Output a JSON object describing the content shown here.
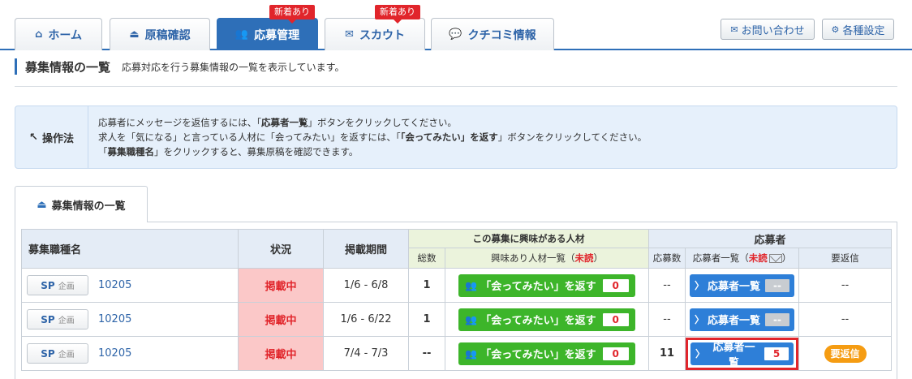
{
  "nav": {
    "tabs": [
      {
        "label": "ホーム",
        "icon": "home-icon",
        "glyph": "⌂",
        "active": false,
        "badge": ""
      },
      {
        "label": "原稿確認",
        "icon": "document-icon",
        "glyph": "⏏",
        "active": false,
        "badge": ""
      },
      {
        "label": "応募管理",
        "icon": "users-icon",
        "glyph": "👥",
        "active": true,
        "badge": "新着あり"
      },
      {
        "label": "スカウト",
        "icon": "mail-icon",
        "glyph": "✉",
        "active": false,
        "badge": "新着あり"
      },
      {
        "label": "クチコミ情報",
        "icon": "chat-icon",
        "glyph": "💬",
        "active": false,
        "badge": ""
      }
    ],
    "contact_label": "お問い合わせ",
    "contact_glyph": "✉",
    "settings_label": "各種設定",
    "settings_glyph": "⚙"
  },
  "header": {
    "title": "募集情報の一覧",
    "description": "応募対応を行う募集情報の一覧を表示しています。"
  },
  "howto": {
    "label": "操作法",
    "glyph": "↖",
    "line1_pre": "応募者にメッセージを返信するには、「",
    "line1_bold": "応募者一覧",
    "line1_post": "」ボタンをクリックしてください。",
    "line2_pre": "求人を「気になる」と言っている人材に「会ってみたい」を返すには、「",
    "line2_bold": "「会ってみたい」を返す",
    "line2_post": "」ボタンをクリックしてください。",
    "line3_pre": "「",
    "line3_bold": "募集職種名",
    "line3_post": "」をクリックすると、募集原稿を確認できます。"
  },
  "list_tab": {
    "label": "募集情報の一覧",
    "glyph": "⏏"
  },
  "table": {
    "headers": {
      "job": "募集職種名",
      "status": "状況",
      "period": "掲載期間",
      "interest_group": "この募集に興味がある人材",
      "applicants_group": "応募者",
      "total": "総数",
      "interest_list_pre": "興味あり人材一覧（",
      "interest_list_unread": "未読",
      "interest_list_post": "）",
      "applicant_count": "応募数",
      "applicant_list_pre": "応募者一覧（",
      "applicant_list_unread": "未読",
      "applicant_list_post": "）",
      "reply_needed": "要返信"
    },
    "rows": [
      {
        "sp_label": "SP",
        "sp_sub": "企画",
        "job_id": "10205",
        "status": "掲載中",
        "period": "1/6 - 6/8",
        "interest_total": "1",
        "meet_label": "「会ってみたい」を返す",
        "meet_count": "0",
        "applicant_count": "--",
        "list_label": "応募者一覧",
        "list_count": "--",
        "reply": "--"
      },
      {
        "sp_label": "SP",
        "sp_sub": "企画",
        "job_id": "10205",
        "status": "掲載中",
        "period": "1/6 - 6/22",
        "interest_total": "1",
        "meet_label": "「会ってみたい」を返す",
        "meet_count": "0",
        "applicant_count": "--",
        "list_label": "応募者一覧",
        "list_count": "--",
        "reply": "--"
      },
      {
        "sp_label": "SP",
        "sp_sub": "企画",
        "job_id": "10205",
        "status": "掲載中",
        "period": "7/4 - 7/3",
        "interest_total": "--",
        "meet_label": "「会ってみたい」を返す",
        "meet_count": "0",
        "applicant_count": "11",
        "list_label": "応募者一覧",
        "list_count": "5",
        "reply": "要返信"
      }
    ]
  },
  "colors": {
    "brand_blue": "#2e6fb8",
    "alert_red": "#e1252b",
    "action_green": "#3db52a",
    "reply_orange": "#f59c12"
  }
}
